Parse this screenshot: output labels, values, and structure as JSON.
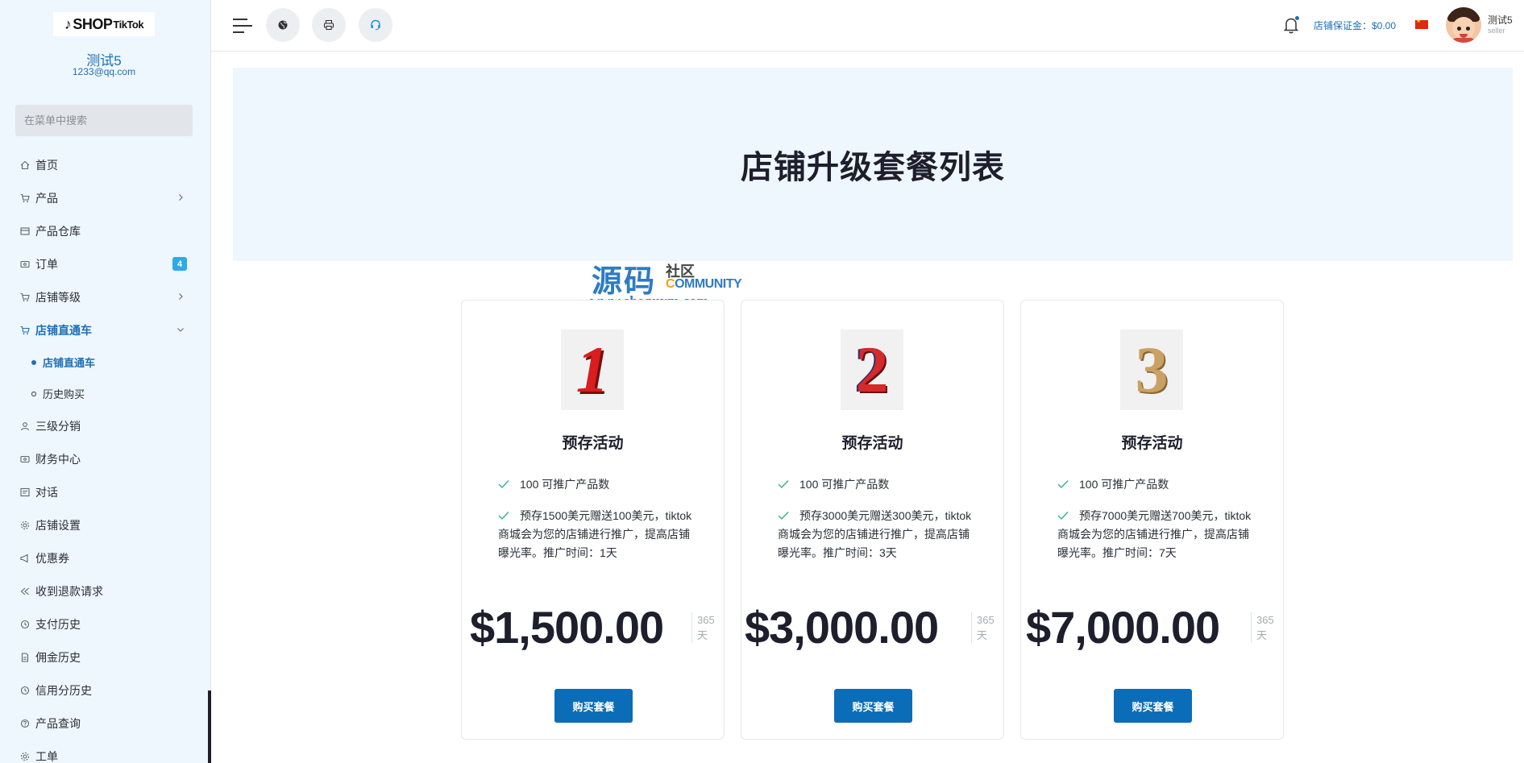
{
  "sidebar": {
    "logo_text": "SHOP",
    "logo_suffix": "TikTok",
    "user_name": "测试5",
    "user_email": "1233@qq.com",
    "search_placeholder": "在菜单中搜索",
    "items": [
      {
        "label": "首页",
        "icon": "home-icon"
      },
      {
        "label": "产品",
        "icon": "cart-icon",
        "has_children": true
      },
      {
        "label": "产品仓库",
        "icon": "warehouse-icon"
      },
      {
        "label": "订单",
        "icon": "order-icon",
        "badge": "4"
      },
      {
        "label": "店铺等级",
        "icon": "cart-icon",
        "has_children": true
      },
      {
        "label": "店铺直通车",
        "icon": "cart-icon",
        "expanded": true,
        "active": true
      },
      {
        "label": "三级分销",
        "icon": "user-icon"
      },
      {
        "label": "财务中心",
        "icon": "wallet-icon"
      },
      {
        "label": "对话",
        "icon": "chat-icon"
      },
      {
        "label": "店铺设置",
        "icon": "settings-icon"
      },
      {
        "label": "优惠券",
        "icon": "megaphone-icon"
      },
      {
        "label": "收到退款请求",
        "icon": "refund-icon"
      },
      {
        "label": "支付历史",
        "icon": "history-icon"
      },
      {
        "label": "佣金历史",
        "icon": "document-icon"
      },
      {
        "label": "信用分历史",
        "icon": "history-icon"
      },
      {
        "label": "产品查询",
        "icon": "help-icon"
      },
      {
        "label": "工单",
        "icon": "gear-icon"
      }
    ],
    "sub_items": [
      {
        "label": "店铺直通车",
        "active": true
      },
      {
        "label": "历史购买",
        "active": false
      }
    ]
  },
  "header": {
    "deposit_label": "店铺保证金：$0.00",
    "user_name": "测试5",
    "user_role": "seller",
    "flag": "china-flag"
  },
  "page": {
    "title": "店铺升级套餐列表"
  },
  "watermark": {
    "cn": "源码",
    "sq": "社区",
    "en_prefix": "C",
    "en_rest": "OMMUNITY",
    "url": "www.shequym.com"
  },
  "plans": [
    {
      "number": "1",
      "title": "预存活动",
      "feature_1": "100 可推广产品数",
      "feature_2": "预存1500美元赠送100美元，tiktok商城会为您的店铺进行推广，提高店铺曝光率。推广时间：1天",
      "price": "$1,500.00",
      "period_num": "365",
      "period_unit": "天",
      "button": "购买套餐"
    },
    {
      "number": "2",
      "title": "预存活动",
      "feature_1": "100 可推广产品数",
      "feature_2": "预存3000美元赠送300美元，tiktok商城会为您的店铺进行推广，提高店铺曝光率。推广时间：3天",
      "price": "$3,000.00",
      "period_num": "365",
      "period_unit": "天",
      "button": "购买套餐"
    },
    {
      "number": "3",
      "title": "预存活动",
      "feature_1": "100 可推广产品数",
      "feature_2": "预存7000美元赠送700美元，tiktok商城会为您的店铺进行推广，提高店铺曝光率。推广时间：7天",
      "price": "$7,000.00",
      "period_num": "365",
      "period_unit": "天",
      "button": "购买套餐"
    }
  ],
  "colors": {
    "accent": "#1d6fb8",
    "button": "#0b6db7",
    "check": "#34b38a",
    "sidebar_bg": "#eef7fd",
    "badge": "#30a9e6"
  }
}
